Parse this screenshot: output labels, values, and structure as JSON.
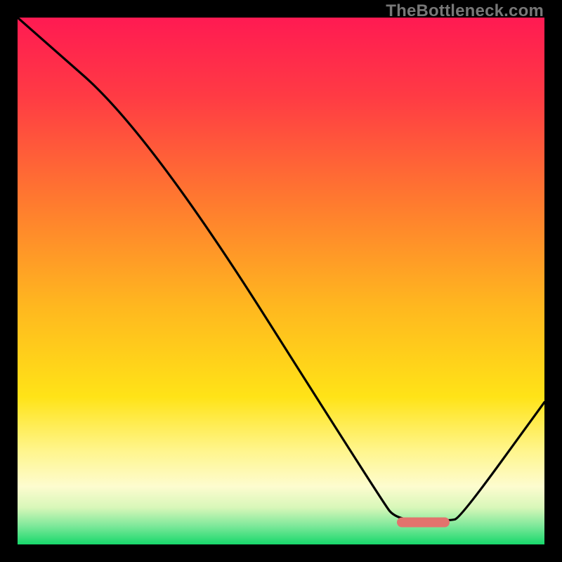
{
  "watermark": "TheBottleneck.com",
  "chart_data": {
    "type": "line",
    "title": "",
    "xlabel": "",
    "ylabel": "",
    "xlim": [
      0,
      100
    ],
    "ylim": [
      0,
      100
    ],
    "series": [
      {
        "name": "curve",
        "x": [
          0,
          25,
          69,
          72,
          82,
          84,
          100
        ],
        "y": [
          100,
          78,
          8.5,
          4.5,
          4.5,
          5,
          27
        ]
      }
    ],
    "marker": {
      "name": "optimal-range",
      "x_start": 72,
      "x_end": 82,
      "y": 4.2,
      "color": "#e2736d"
    },
    "gradient_stops": [
      {
        "offset": 0.0,
        "color": "#ff1a52"
      },
      {
        "offset": 0.15,
        "color": "#ff3b44"
      },
      {
        "offset": 0.35,
        "color": "#ff7a2f"
      },
      {
        "offset": 0.55,
        "color": "#ffb81f"
      },
      {
        "offset": 0.72,
        "color": "#ffe317"
      },
      {
        "offset": 0.82,
        "color": "#fff58a"
      },
      {
        "offset": 0.89,
        "color": "#fdfccf"
      },
      {
        "offset": 0.93,
        "color": "#d8f7b9"
      },
      {
        "offset": 0.965,
        "color": "#7de89a"
      },
      {
        "offset": 1.0,
        "color": "#17d86b"
      }
    ]
  }
}
